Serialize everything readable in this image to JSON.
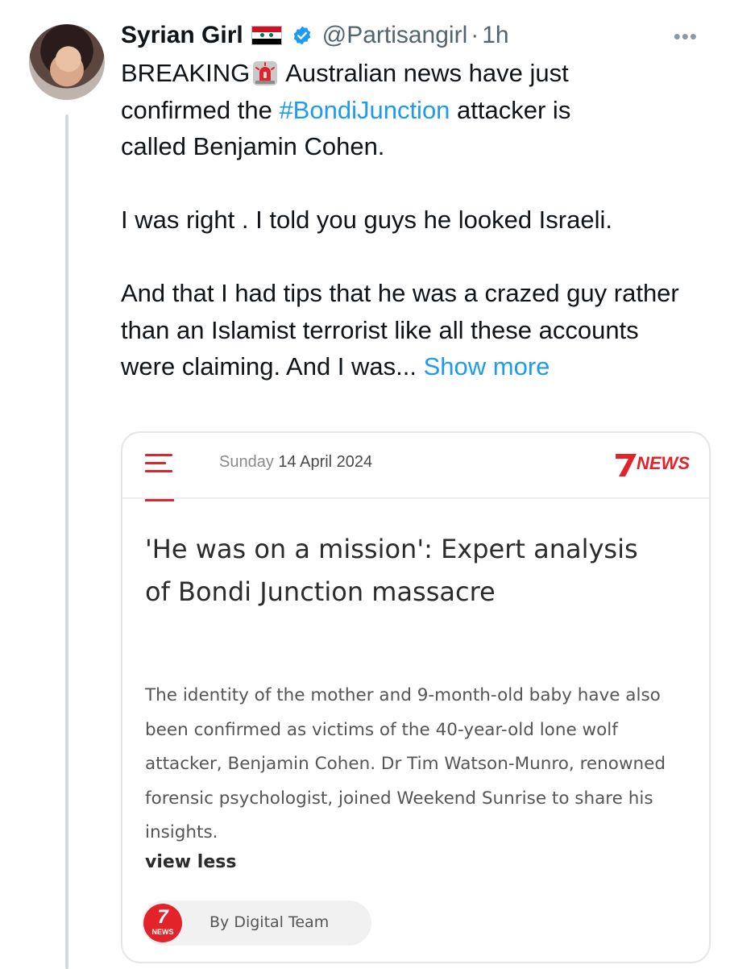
{
  "tweet": {
    "name": "Syrian Girl",
    "handle": "@Partisangirl",
    "separator": "·",
    "time": "1h",
    "more_label": "•••",
    "line1_before": "BREAKING",
    "line1_after": "Australian news have just",
    "line2_before": "confirmed the ",
    "hashtag": "#BondiJunction",
    "line2_after": " attacker is",
    "line3": "called Benjamin Cohen.",
    "para2": "I was right . I told you guys he looked Israeli.",
    "para3": "And that I had tips that he was a crazed guy rather than an Islamist terrorist like all these accounts were claiming. And I was...",
    "show_more": "Show more"
  },
  "card": {
    "day": "Sunday",
    "date": "14 April 2024",
    "logo_text": "NEWS",
    "headline": "'He was on a mission': Expert analysis of Bondi Junction massacre",
    "summary": "The identity of the mother and 9-month-old baby have also been confirmed as victims of the 40-year-old lone wolf attacker, Benjamin Cohen. Dr Tim Watson-Munro, renowned forensic psychologist, joined Weekend Sunrise to share his insights.",
    "view_less": "view less",
    "author_logo_seven": "7",
    "author_logo_news": "NEWS",
    "author": "By Digital Team"
  },
  "colors": {
    "link": "#1d9bf0",
    "brand_red": "#e2232a",
    "verified": "#1d9bf0"
  },
  "icons": [
    "syria-flag-icon",
    "verified-badge-icon",
    "siren-emoji-icon",
    "hamburger-menu-icon",
    "seven-news-logo-icon"
  ]
}
